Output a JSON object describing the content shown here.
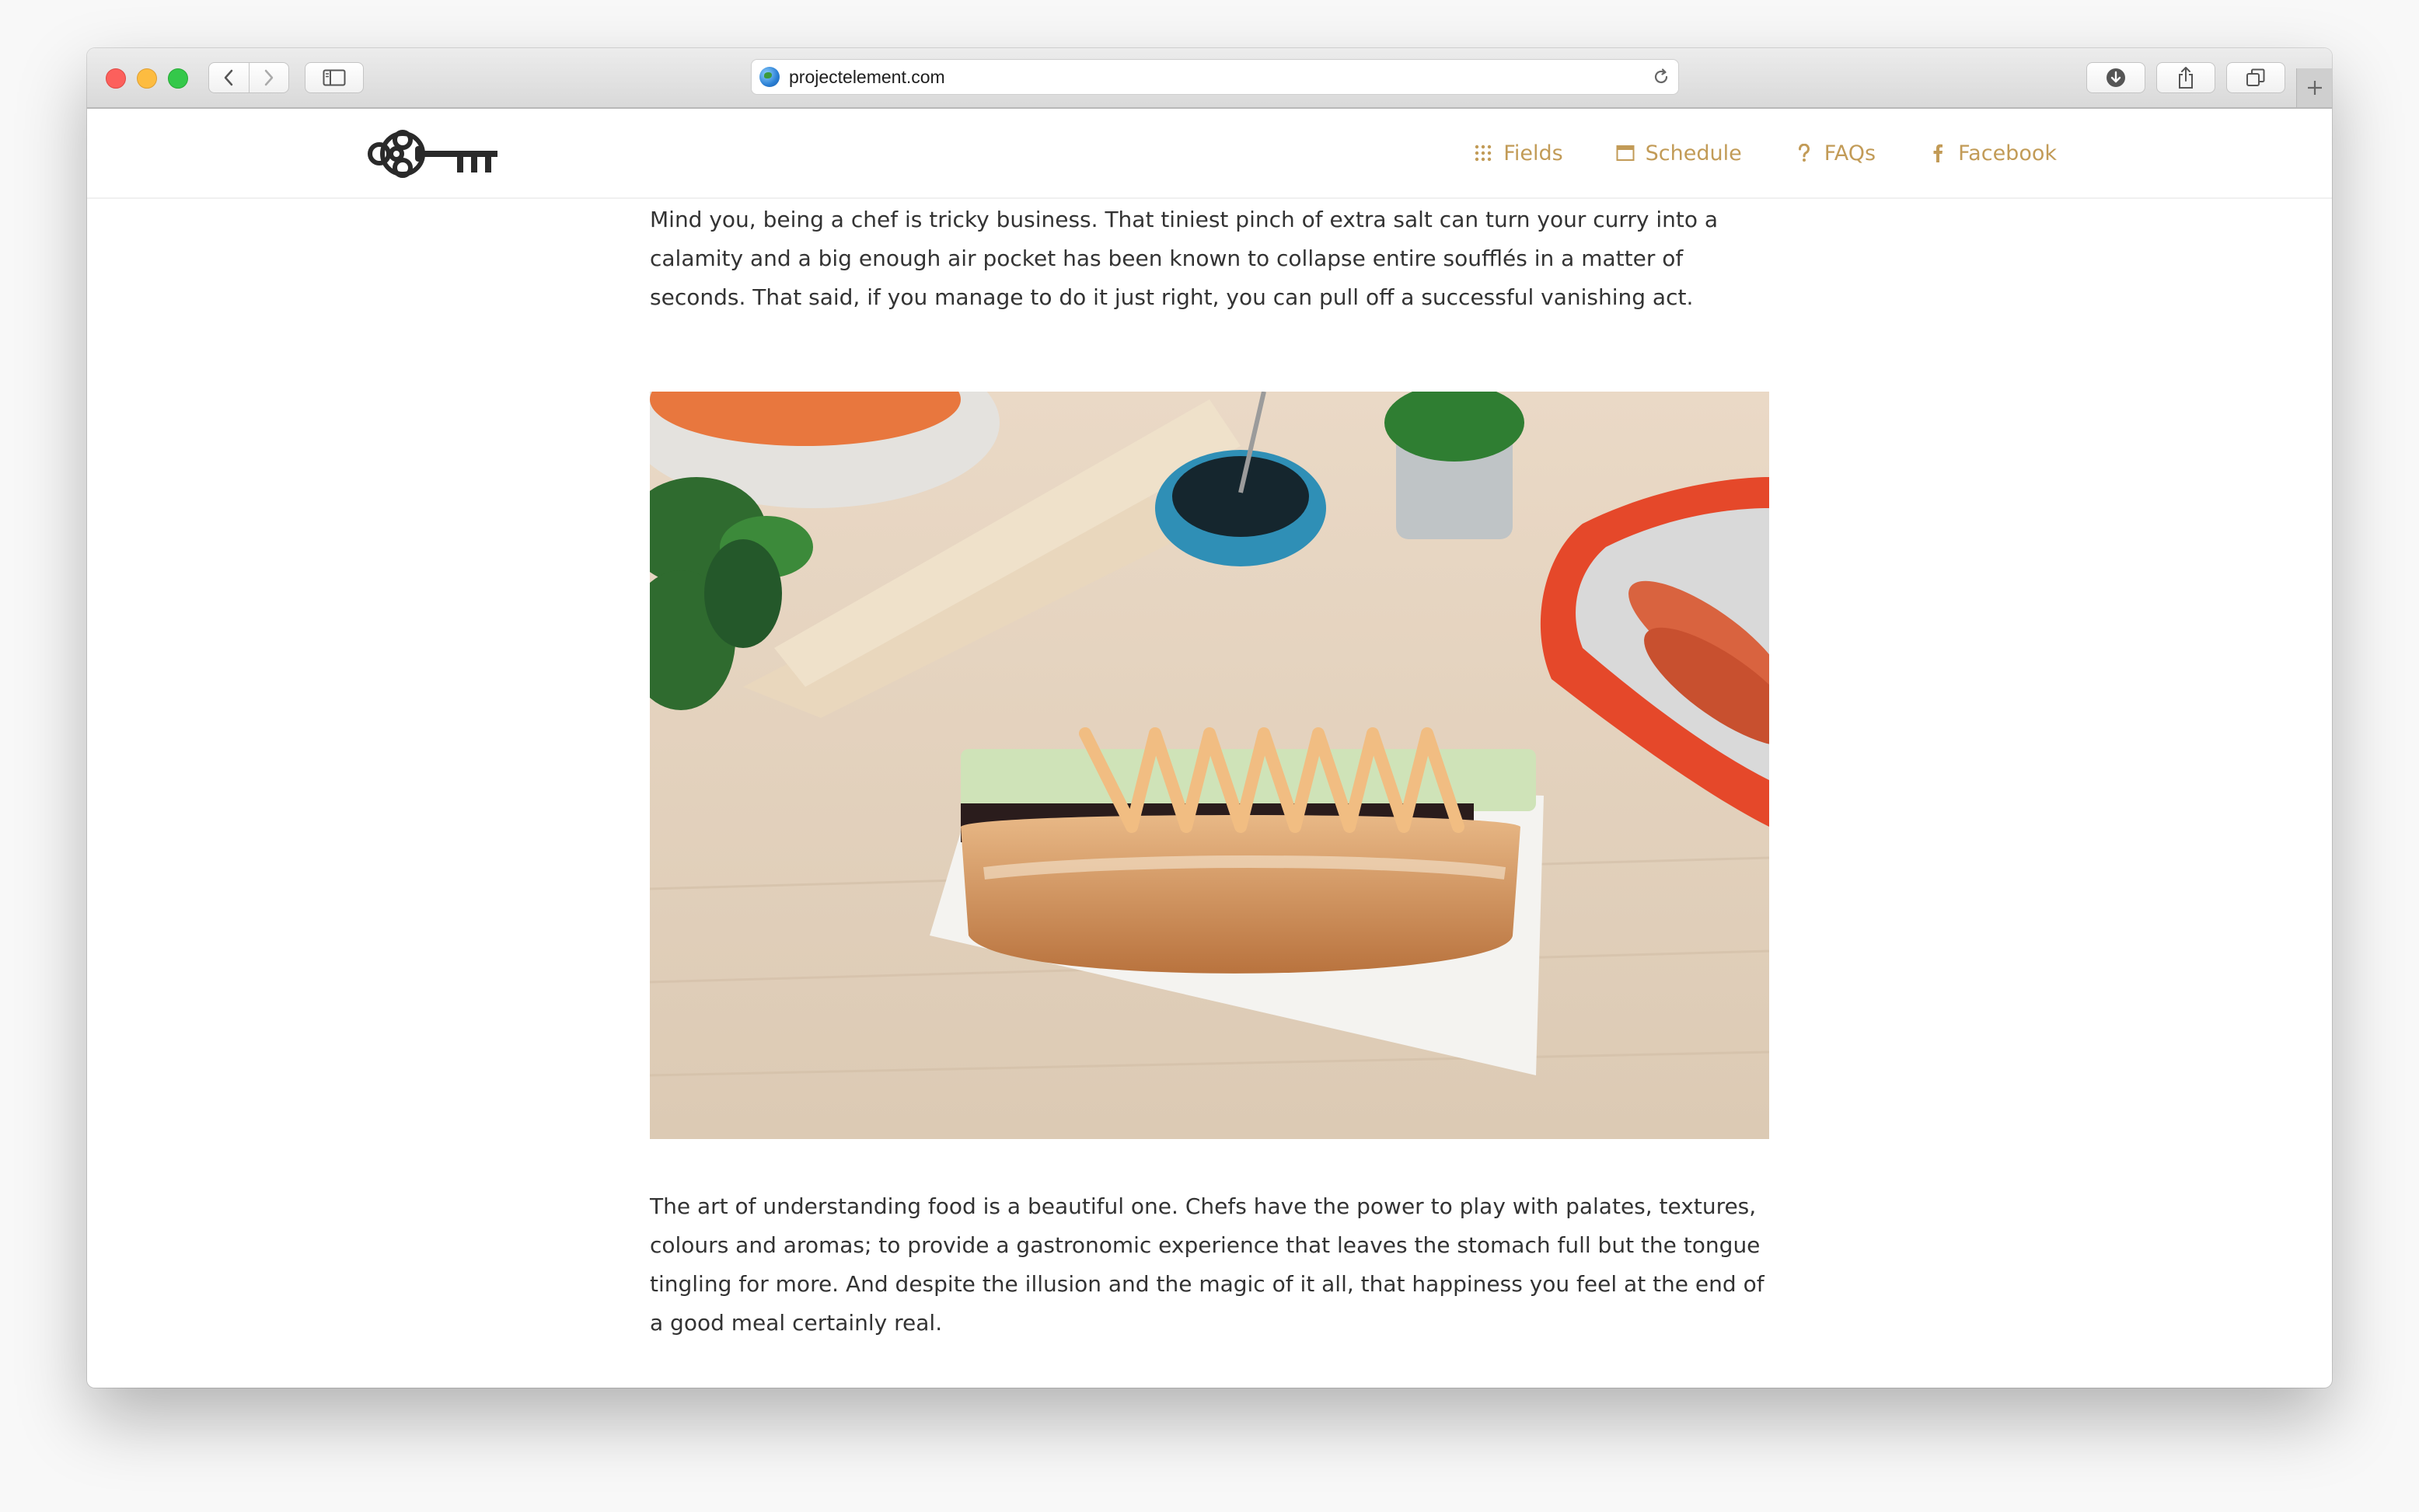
{
  "browser": {
    "url": "projectelement.com"
  },
  "site": {
    "nav": [
      {
        "label": "Fields",
        "icon": "grid-dots-icon"
      },
      {
        "label": "Schedule",
        "icon": "calendar-icon"
      },
      {
        "label": "FAQs",
        "icon": "question-mark-icon"
      },
      {
        "label": "Facebook",
        "icon": "facebook-icon"
      }
    ],
    "accent_color": "#c29b57"
  },
  "article": {
    "paragraph_1": "Mind you, being a chef is tricky business. That tiniest pinch of extra salt can turn your curry into a calamity and a big enough air pocket has been known to collapse entire soufflés in a matter of seconds. That said, if you manage to do it just right, you can pull off a successful vanishing act.",
    "paragraph_2": "The art of understanding food is a beautiful one. Chefs have the power to play with palates, textures, colours and aromas; to provide a gastronomic experience that leaves the stomach full but the tongue tingling for more. And despite the illusion and the magic of it all, that happiness you feel at the end of a good meal certainly real."
  }
}
